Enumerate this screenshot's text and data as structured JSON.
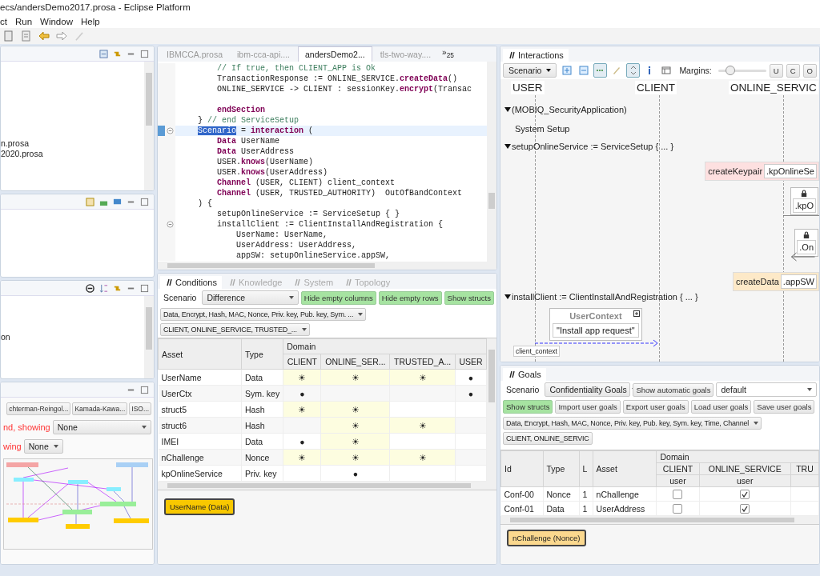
{
  "window": {
    "title": "ecs/andersDemo2017.prosa - Eclipse Platform"
  },
  "menu": [
    "ct",
    "Run",
    "Window",
    "Help"
  ],
  "explorer": {
    "items": [
      "n.prosa",
      "2020.prosa"
    ]
  },
  "outline": {
    "items": [
      "on"
    ]
  },
  "graph_view": {
    "layouts": [
      "chterman-Reingol...",
      "Kamada-Kawa...",
      "ISO..."
    ],
    "filters": [
      {
        "label": "nd, showing",
        "value": "None",
        "wide": true
      },
      {
        "label": "wing",
        "value": "None",
        "wide": false
      }
    ]
  },
  "editor": {
    "tabs": [
      {
        "label": "IBMCCA.prosa",
        "selected": false
      },
      {
        "label": "ibm-cca-api....",
        "selected": false
      },
      {
        "label": "andersDemo2...",
        "selected": true
      },
      {
        "label": "tls-two-way....",
        "selected": false
      }
    ],
    "overflow": "»$_{25}$",
    "lines": [
      {
        "current": false,
        "fold": false,
        "comment": "    // If true, then CLIENT_APP is Ok"
      },
      {
        "current": false,
        "fold": false,
        "code": "    TransactionResponse := ONLINE_SERVICE.**createData**()"
      },
      {
        "current": false,
        "fold": false,
        "code": "    ONLINE_SERVICE -> CLIENT : sessionKey.**encrypt**(Transac"
      },
      {
        "current": false,
        "fold": false
      },
      {
        "current": false,
        "fold": false,
        "code": "    **endSection**"
      },
      {
        "current": false,
        "fold": false,
        "code": "} ",
        "comment": "// end ServiceSetup"
      },
      {
        "current": true,
        "fold": true,
        "selection": "Scenario",
        "code": " = **interaction** ("
      },
      {
        "current": false,
        "fold": false,
        "code": "    **Data** UserName"
      },
      {
        "current": false,
        "fold": false,
        "code": "    **Data** UserAddress"
      },
      {
        "current": false,
        "fold": false,
        "code": "    USER.**knows**(UserName)"
      },
      {
        "current": false,
        "fold": false,
        "code": "    USER.**knows**(UserAddress)"
      },
      {
        "current": false,
        "fold": false,
        "code": "    **Channel** (USER, CLIENT) client_context"
      },
      {
        "current": false,
        "fold": false,
        "code": "    **Channel** (USER, TRUSTED_AUTHORITY)  OutOfBandContext"
      },
      {
        "current": false,
        "fold": false,
        "code": ") {"
      },
      {
        "current": false,
        "fold": false,
        "code": "    setupOnlineService := ServiceSetup { }"
      },
      {
        "current": false,
        "fold": true,
        "code": "    installClient := ClientInstallAndRegistration {"
      },
      {
        "current": false,
        "fold": false,
        "code": "        UserName: UserName,"
      },
      {
        "current": false,
        "fold": false,
        "code": "        UserAddress: UserAddress,"
      },
      {
        "current": false,
        "fold": false,
        "code": "        appSW: setupOnlineService.appSW,"
      }
    ]
  },
  "conditions": {
    "tabs": [
      {
        "label": "Conditions",
        "selected": true
      },
      {
        "label": "Knowledge",
        "selected": false
      },
      {
        "label": "System",
        "selected": false
      },
      {
        "label": "Topology",
        "selected": false
      }
    ],
    "scenario_label": "Scenario",
    "mode": "Difference",
    "toggles": [
      {
        "label": "Hide empty columns",
        "on": true
      },
      {
        "label": "Hide empty rows",
        "on": true
      },
      {
        "label": "Show structs",
        "on": true
      }
    ],
    "type_filter": "Data, Encrypt, Hash, MAC, Nonce, Priv. key, Pub. key, Sym. ...",
    "domain_filter": "CLIENT, ONLINE_SERVICE, TRUSTED_...",
    "columns": [
      "Asset",
      "Type"
    ],
    "group": "Domain",
    "domains": [
      "CLIENT",
      "ONLINE_SER...",
      "TRUSTED_A...",
      "USER"
    ],
    "rows": [
      {
        "asset": "UserName",
        "type": "Data",
        "cells": [
          {
            "mark": "☀",
            "highlighted": true
          },
          {
            "mark": "☀",
            "highlighted": true
          },
          {
            "mark": "☀",
            "highlighted": true
          },
          {
            "mark": "●",
            "highlighted": false
          }
        ]
      },
      {
        "asset": "UserCtx",
        "type": "Sym. key",
        "cells": [
          {
            "mark": "●",
            "highlighted": false
          },
          {
            "highlighted": false
          },
          {
            "highlighted": false
          },
          {
            "mark": "●",
            "highlighted": false
          }
        ]
      },
      {
        "asset": "struct5",
        "type": "Hash",
        "cells": [
          {
            "mark": "☀",
            "highlighted": true
          },
          {
            "mark": "☀",
            "highlighted": true
          },
          {
            "highlighted": false
          },
          {
            "highlighted": false
          }
        ]
      },
      {
        "asset": "struct6",
        "type": "Hash",
        "cells": [
          {
            "highlighted": false
          },
          {
            "mark": "☀",
            "highlighted": true
          },
          {
            "mark": "☀",
            "highlighted": true
          },
          {
            "highlighted": false
          }
        ]
      },
      {
        "asset": "IMEI",
        "type": "Data",
        "cells": [
          {
            "mark": "●",
            "highlighted": false
          },
          {
            "mark": "☀",
            "highlighted": true
          },
          {
            "highlighted": false
          },
          {
            "highlighted": false
          }
        ]
      },
      {
        "asset": "nChallenge",
        "type": "Nonce",
        "cells": [
          {
            "mark": "☀",
            "highlighted": true
          },
          {
            "mark": "☀",
            "highlighted": true
          },
          {
            "mark": "☀",
            "highlighted": true
          },
          {
            "highlighted": false
          }
        ]
      },
      {
        "asset": "kpOnlineService",
        "type": "Priv. key",
        "cells": [
          {
            "highlighted": false
          },
          {
            "mark": "●",
            "highlighted": false
          },
          {
            "highlighted": false
          },
          {
            "highlighted": false
          }
        ]
      }
    ],
    "chip": "UserName (Data)"
  },
  "interactions": {
    "tab": "Interactions",
    "scenario": "Scenario",
    "margins_label": "Margins:",
    "margins": {
      "level": 0.26
    },
    "tools": [
      {
        "kind": "expand",
        "pressed": false
      },
      {
        "kind": "collapse",
        "pressed": false
      },
      {
        "kind": "dots",
        "pressed": true
      },
      {
        "kind": "pen",
        "pressed": false
      },
      {
        "kind": "updown",
        "pressed": true
      },
      {
        "kind": "info",
        "pressed": false
      },
      {
        "kind": "window",
        "pressed": false
      }
    ],
    "letters": [
      "U",
      "C",
      "O"
    ],
    "lifelines": [
      "USER",
      "CLIENT",
      "ONLINE_SERVIC"
    ],
    "sections": [
      {
        "label": "(MOBIQ_SecurityApplication)",
        "expanded": true
      },
      {
        "label": "setupOnlineService := ServiceSetup { ... }",
        "expanded": true
      },
      {
        "label": "installClient := ClientInstallAndRegistration { ... }",
        "expanded": true
      }
    ],
    "note": "System Setup",
    "actions": [
      {
        "name": "createKeypair",
        "arg": ".kpOnlineSe",
        "color": "#fde0e0"
      },
      {
        "name": "createData",
        "arg": ".appSW",
        "color": "#fde9c8"
      }
    ],
    "messages": [
      ".kpO",
      ".On"
    ],
    "context": {
      "title": "UserContext",
      "value": "\"Install app request\"",
      "channel": "client_context"
    }
  },
  "goals": {
    "tab": "Goals",
    "scenario_label": "Scenario",
    "goal_type": "Confidentiality Goals",
    "auto_button": "Show automatic goals",
    "profile": "default",
    "buttons": [
      {
        "label": "Show structs",
        "on": true
      },
      {
        "label": "Import user goals",
        "on": false
      },
      {
        "label": "Export user goals",
        "on": false
      },
      {
        "label": "Load user goals",
        "on": false
      },
      {
        "label": "Save user goals",
        "on": false
      }
    ],
    "type_filter": "Data, Encrypt, Hash, MAC, Nonce, Priv. key, Pub. key, Sym. key, Time, Channel",
    "domain_filter": "CLIENT, ONLINE_SERVIC",
    "columns": [
      "Id",
      "Type",
      "L",
      "Asset"
    ],
    "group": "Domain",
    "domains": [
      {
        "name": "CLIENT",
        "role": "user"
      },
      {
        "name": "ONLINE_SERVICE",
        "role": "user"
      },
      {
        "name": "TRU"
      }
    ],
    "rows": [
      {
        "id": "Conf-00",
        "type": "Nonce",
        "l": "1",
        "asset": "nChallenge",
        "checks": [
          false,
          true
        ]
      },
      {
        "id": "Conf-01",
        "type": "Data",
        "l": "1",
        "asset": "UserAddress",
        "checks": [
          false,
          true
        ]
      }
    ],
    "chip": "nChallenge (Nonce)"
  }
}
